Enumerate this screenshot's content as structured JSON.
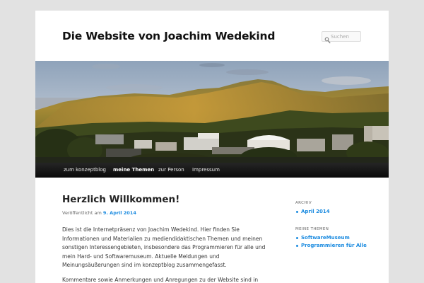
{
  "site": {
    "title": "Die Website von Joachim Wedekind"
  },
  "search": {
    "placeholder": "Suchen",
    "icon": "search-icon"
  },
  "nav": {
    "items": [
      {
        "label": "zum konzeptblog",
        "current": false
      },
      {
        "label": "meine Themen",
        "current": true
      },
      {
        "label": "zur Person",
        "current": false
      },
      {
        "label": "Impressum",
        "current": false
      }
    ]
  },
  "post": {
    "title": "Herzlich Willkommen!",
    "meta_prefix": "Veröffentlicht am",
    "meta_date": "9. April 2014",
    "paragraph1_lines": [
      "Dies ist die Internetpräsenz von Joachim Wedekind. Hier finden Sie",
      "Informationen und Materialien zu mediendidaktischen Themen und meinen",
      "sonstigen Interessengebieten, insbesondere das Programmieren für alle und",
      "mein Hard- und Softwaremuseum. Aktuelle Meldungen und",
      "Meinungsäußerungen sind im konzeptblog zusammengefasst."
    ],
    "paragraph2_lines": [
      "Kommentare sowie Anmerkungen und Anregungen zu der Website sind in"
    ]
  },
  "sidebar": {
    "archive": {
      "title": "ARCHIV",
      "items": [
        "April 2014"
      ]
    },
    "topics": {
      "title": "MEINE THEMEN",
      "items": [
        "SoftwareMuseum",
        "Programmieren für Alle"
      ]
    }
  },
  "colors": {
    "link": "#1b8be0",
    "nav_background": "#111111",
    "page_background": "#e2e2e2"
  }
}
